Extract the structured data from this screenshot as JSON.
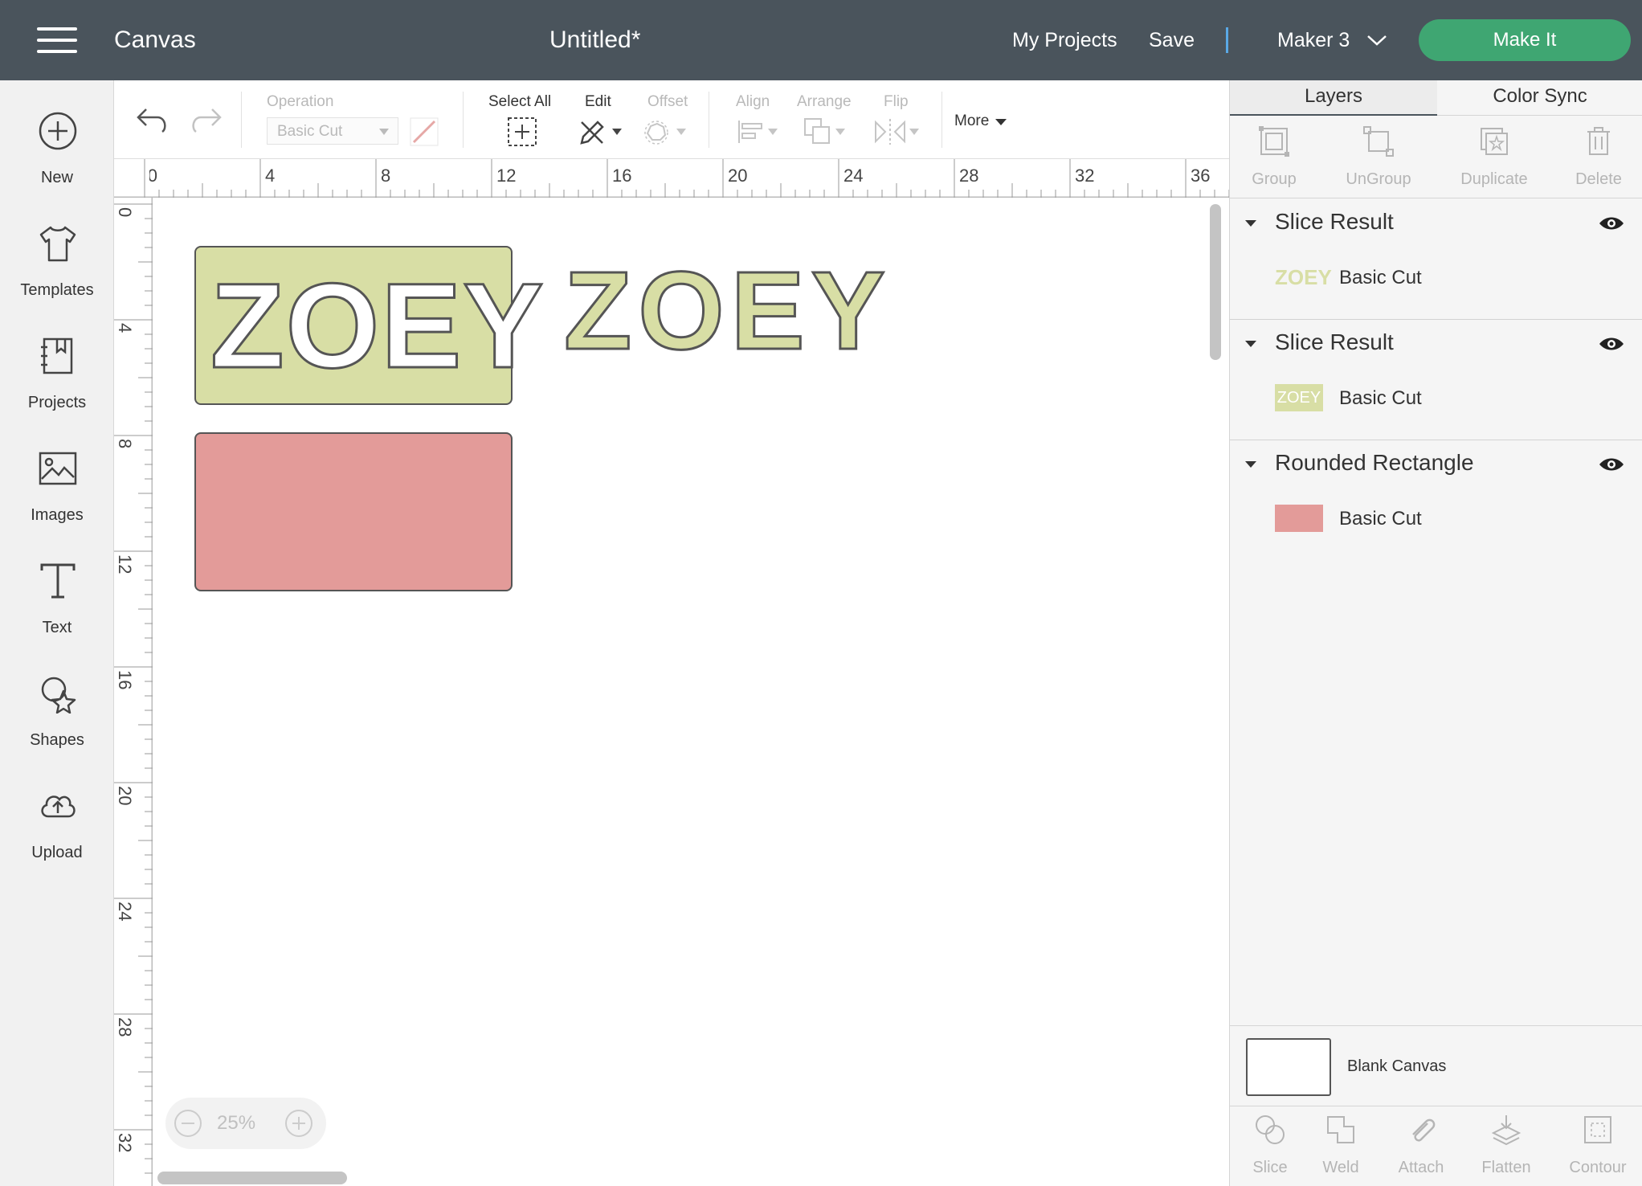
{
  "header": {
    "app_name": "Canvas",
    "doc_title": "Untitled*",
    "my_projects": "My Projects",
    "save": "Save",
    "machine": "Maker 3",
    "make_it": "Make It"
  },
  "sidebar": {
    "items": [
      {
        "label": "New",
        "icon": "plus-circle-icon"
      },
      {
        "label": "Templates",
        "icon": "tshirt-icon"
      },
      {
        "label": "Projects",
        "icon": "projects-icon"
      },
      {
        "label": "Images",
        "icon": "image-icon"
      },
      {
        "label": "Text",
        "icon": "text-icon"
      },
      {
        "label": "Shapes",
        "icon": "shapes-icon"
      },
      {
        "label": "Upload",
        "icon": "upload-cloud-icon"
      }
    ]
  },
  "toolbar": {
    "operation_label": "Operation",
    "operation_value": "Basic Cut",
    "select_all": "Select All",
    "edit": "Edit",
    "offset": "Offset",
    "align": "Align",
    "arrange": "Arrange",
    "flip": "Flip",
    "more": "More"
  },
  "ruler": {
    "h_labels": [
      "0",
      "4",
      "8",
      "12",
      "16",
      "20",
      "24",
      "28",
      "32",
      "36"
    ],
    "v_labels": [
      "0",
      "4",
      "8",
      "12",
      "16",
      "20",
      "24",
      "28",
      "32"
    ]
  },
  "canvas": {
    "text_object": "ZOEY",
    "zoom": "25%",
    "colors": {
      "green": "#d8dea5",
      "pink": "#e39b99",
      "outline": "#555555"
    }
  },
  "panel": {
    "tabs": [
      "Layers",
      "Color Sync"
    ],
    "actions": [
      "Group",
      "UnGroup",
      "Duplicate",
      "Delete"
    ],
    "layers": [
      {
        "title": "Slice Result",
        "sub": "Basic Cut",
        "thumb_text": "ZOEY"
      },
      {
        "title": "Slice Result",
        "sub": "Basic Cut",
        "thumb_text": "ZOEY"
      },
      {
        "title": "Rounded Rectangle",
        "sub": "Basic Cut",
        "thumb_text": ""
      }
    ],
    "blank_canvas": "Blank Canvas",
    "bottom_actions": [
      "Slice",
      "Weld",
      "Attach",
      "Flatten",
      "Contour"
    ]
  }
}
